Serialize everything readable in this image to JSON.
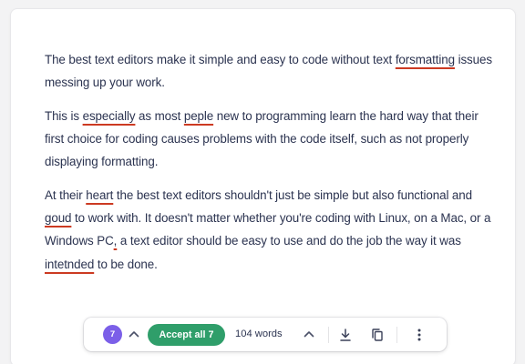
{
  "document": {
    "paragraphs": [
      {
        "segments": [
          {
            "text": "The best text editors make it simple and easy to code without text ",
            "error": false
          },
          {
            "text": "forsmatting",
            "error": true
          },
          {
            "text": " issues messing up your work.",
            "error": false
          }
        ]
      },
      {
        "segments": [
          {
            "text": "This is ",
            "error": false
          },
          {
            "text": "especially",
            "error": true
          },
          {
            "text": " as most ",
            "error": false
          },
          {
            "text": "peple",
            "error": true
          },
          {
            "text": " new to programming learn the hard way that their first choice for coding causes problems with the code itself, such as not properly displaying formatting.",
            "error": false
          }
        ]
      },
      {
        "segments": [
          {
            "text": "At their ",
            "error": false
          },
          {
            "text": "heart",
            "error": true
          },
          {
            "text": " the best text editors shouldn't just be simple but also functional and ",
            "error": false
          },
          {
            "text": "goud",
            "error": true
          },
          {
            "text": " to work with. It doesn't matter whether you're coding with Linux, on a Mac, or a Windows PC",
            "error": false
          },
          {
            "text": ",",
            "error": true
          },
          {
            "text": " a text editor should be easy to use and do the job the way it was ",
            "error": false
          },
          {
            "text": "intetnded",
            "error": true
          },
          {
            "text": " to be done.",
            "error": false
          }
        ]
      }
    ]
  },
  "toolbar": {
    "issue_count": "7",
    "accept_label": "Accept all 7",
    "word_count": "104 words"
  },
  "icons": {
    "issue_chevron": "chevron-up-icon",
    "stats_chevron": "chevron-up-icon",
    "download": "download-icon",
    "copy": "copy-icon",
    "more": "more-vertical-icon"
  },
  "colors": {
    "issue_badge": "#7b5fe8",
    "accept_button": "#2f9e6a",
    "error_underline": "#cc3a22",
    "text": "#2b3350"
  }
}
